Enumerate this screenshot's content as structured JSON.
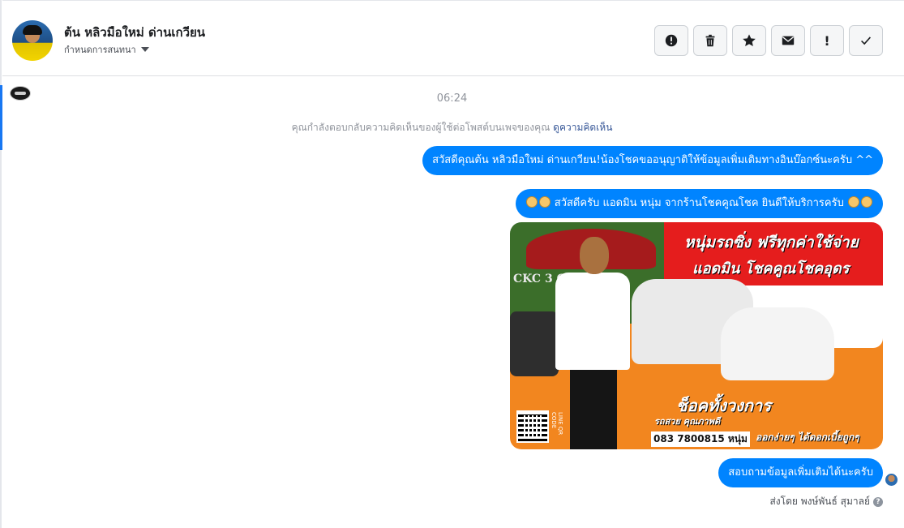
{
  "header": {
    "contact_name": "ต้น หลิวมือใหม่ ด่านเกวียน",
    "assign_label": "กำหนดการสนทนา",
    "toolbar": {
      "icons": [
        "alert-circle-icon",
        "trash-icon",
        "star-icon",
        "envelope-icon",
        "exclamation-icon",
        "check-icon"
      ],
      "exclamation_glyph": "!"
    }
  },
  "conversation": {
    "timestamp": "06:24",
    "notice_text": "คุณกำลังตอบกลับความคิดเห็นของผู้ใช้ต่อโพสต์บนเพจของคุณ",
    "notice_link": "ดูความคิดเห็น",
    "messages": [
      {
        "text": "สวัสดีคุณต้น หลิวมือใหม่ ด่านเกวียน!น้องโชคขออนุญาติให้ข้อมูลเพิ่มเติมทางอินบ๊อกซ์นะครับ ^^"
      },
      {
        "text": "สวัสดีครับ แอดมิน หนุ่ม จากร้านโชคคูณโชค ยินดีให้บริการครับ"
      },
      {
        "text": "สอบถามข้อมูลเพิ่มเติมได้นะครับ"
      }
    ],
    "ad_image": {
      "logo_text": "CKC 3  COM",
      "headline_1": "หนุ่มรถซิ่ง ฟรีทุกค่าใช้จ่าย",
      "headline_2": "แอดมิน โชคคูณโชคอุดร",
      "choice_text": "ช็อคทั้งวงการ",
      "line_3": "รถสวย คุณภาพดี",
      "phone": "083 7800815",
      "nick": "หนุ่ม",
      "tagline": "ออกง่ายๆ ได้ดอกเบี้ยถูกๆ",
      "qr_label": "LINE QR CODE"
    },
    "sent_by": "ส่งโดย พงษ์พันธ์ สุมาลย์"
  },
  "colors": {
    "bubble": "#0084ff",
    "link": "#385898",
    "muted": "#90949c",
    "active_bar": "#1877f2"
  }
}
